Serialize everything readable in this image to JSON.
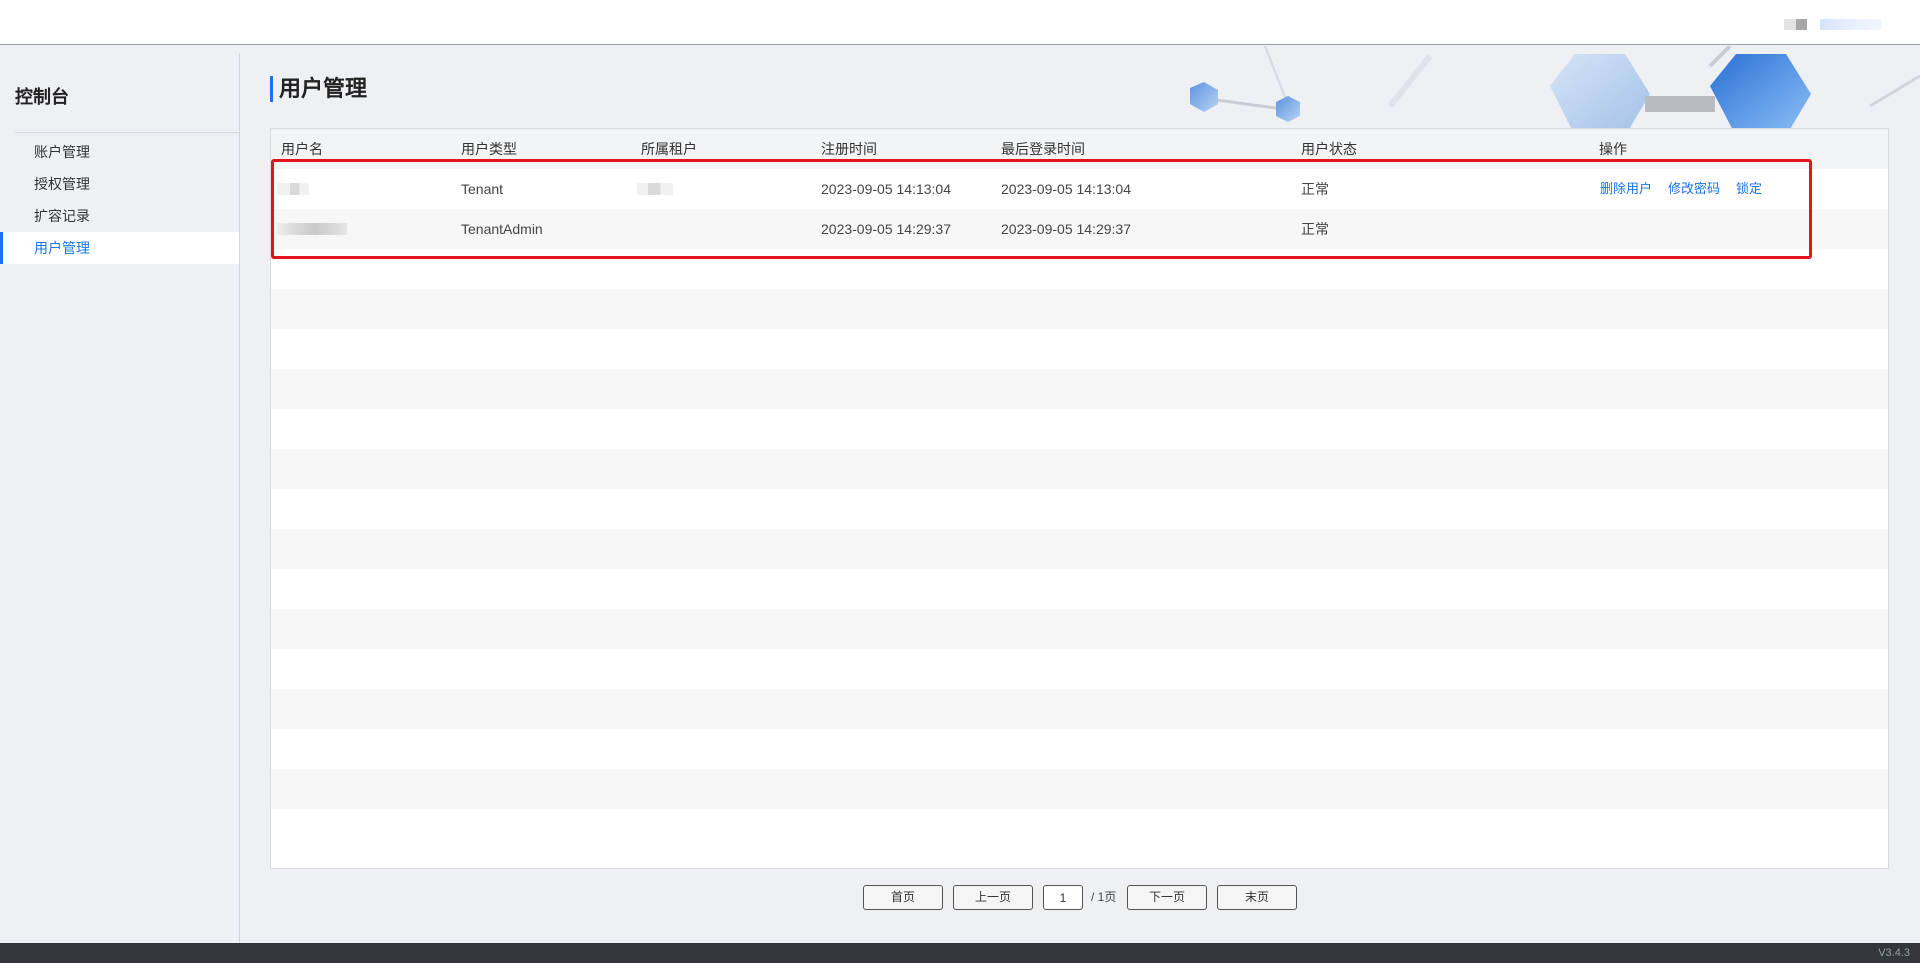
{
  "header": {
    "user_display": ""
  },
  "sidebar": {
    "title": "控制台",
    "items": [
      {
        "label": "账户管理",
        "active": false
      },
      {
        "label": "授权管理",
        "active": false
      },
      {
        "label": "扩容记录",
        "active": false
      },
      {
        "label": "用户管理",
        "active": true
      }
    ]
  },
  "page": {
    "title": "用户管理"
  },
  "table": {
    "columns": [
      "用户名",
      "用户类型",
      "所属租户",
      "注册时间",
      "最后登录时间",
      "用户状态",
      "操作"
    ],
    "rows": [
      {
        "username": "",
        "user_type": "Tenant",
        "tenant": "",
        "register_time": "2023-09-05 14:13:04",
        "last_login": "2023-09-05 14:13:04",
        "status": "正常",
        "actions": [
          "删除用户",
          "修改密码",
          "锁定"
        ]
      },
      {
        "username": "",
        "user_type": "TenantAdmin",
        "tenant": "",
        "register_time": "2023-09-05 14:29:37",
        "last_login": "2023-09-05 14:29:37",
        "status": "正常",
        "actions": []
      }
    ]
  },
  "pagination": {
    "first": "首页",
    "prev": "上一页",
    "current": "1",
    "total": "/ 1页",
    "next": "下一页",
    "last": "末页"
  },
  "footer": {
    "version": "V3.4.3"
  },
  "colors": {
    "accent": "#1a73e8",
    "highlight_border": "#e0151e",
    "footer_bg": "#33373d"
  }
}
